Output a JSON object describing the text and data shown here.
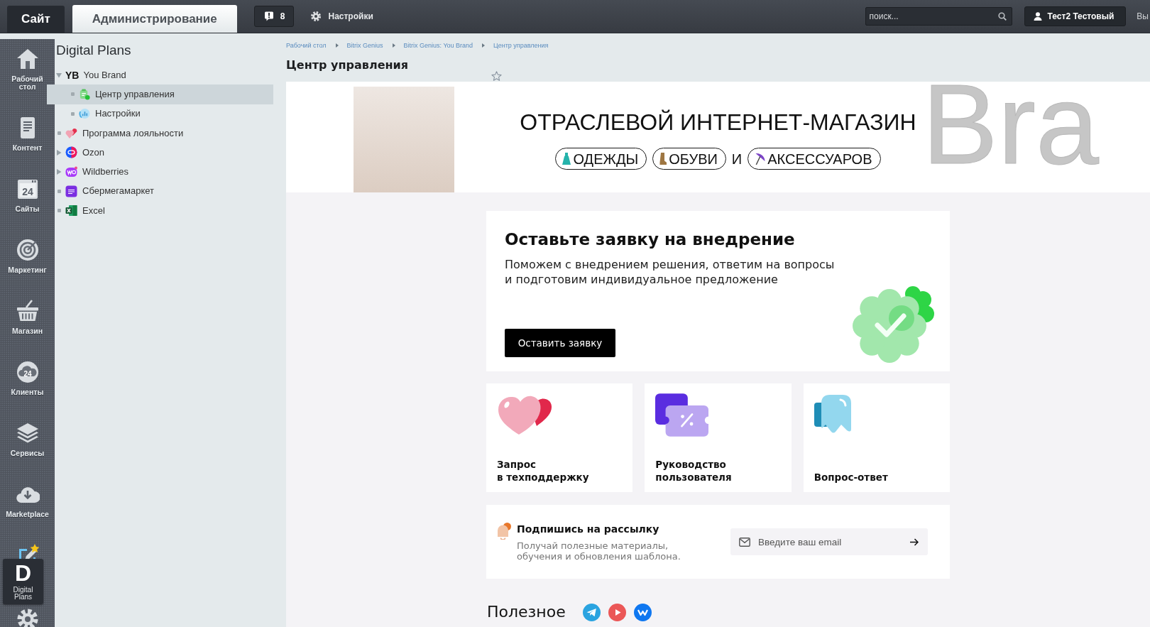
{
  "top_bar": {
    "tabs": [
      {
        "label": "Сайт",
        "selected": false
      },
      {
        "label": "Администрирование",
        "selected": true
      }
    ],
    "notifications": {
      "count": "8"
    },
    "settings": {
      "label": "Настройки"
    },
    "search": {
      "placeholder": "поиск..."
    },
    "user": {
      "name": "Тест2 Тестовый"
    },
    "logout": {
      "label": "Вы"
    }
  },
  "sidebar": {
    "items": [
      {
        "kind": "entry",
        "label": "Рабочий стол"
      },
      {
        "kind": "entry",
        "label": "Контент"
      },
      {
        "kind": "entry",
        "label": "Сайты",
        "icon_text": "24"
      },
      {
        "kind": "entry",
        "label": "Маркетинг"
      },
      {
        "kind": "entry",
        "label": "Магазин"
      },
      {
        "kind": "entry",
        "label": "Клиенты",
        "icon_text": "24"
      },
      {
        "kind": "entry",
        "label": "Сервисы"
      },
      {
        "kind": "entry",
        "label": "Marketplace"
      },
      {
        "kind": "icon"
      },
      {
        "kind": "icon"
      }
    ],
    "popup": {
      "logo": "D",
      "label": "Digital Plans"
    }
  },
  "tree": {
    "title": "Digital Plans",
    "items": [
      {
        "label": "You Brand",
        "badge": "YB",
        "expanded": true,
        "selected": false,
        "children": [
          {
            "label": "Центр управления",
            "selected": true
          },
          {
            "label": "Настройки",
            "selected": false
          }
        ]
      },
      {
        "label": "Программа лояльности",
        "selected": false
      },
      {
        "label": "Ozon",
        "expanded": false,
        "selected": false
      },
      {
        "label": "Wildberries",
        "expanded": false,
        "selected": false
      },
      {
        "label": "Сбермегамаркет",
        "selected": false
      },
      {
        "label": "Excel",
        "selected": false
      }
    ]
  },
  "content": {
    "breadcrumbs": [
      "Рабочий стол",
      "Bitrix Genius",
      "Bitrix Genius: You Brand",
      "Центр управления"
    ],
    "title": "Центр управления",
    "favorite": {
      "starred": false
    },
    "banner": {
      "heading": "ОТРАСЛЕВОЙ ИНТЕРНЕТ-МАГАЗИН",
      "tags": [
        {
          "kind": "pill",
          "label": "ОДЕЖДЫ"
        },
        {
          "kind": "pill",
          "label": "ОБУВИ"
        },
        {
          "kind": "word",
          "label": "И"
        },
        {
          "kind": "pill",
          "label": "АКСЕССУАРОВ"
        }
      ],
      "backdrop": "Bra"
    },
    "request": {
      "title": "Оставьте заявку на внедрение",
      "text": "Поможем с внедрением решения, ответим на вопросы\nи подготовим индивидуальное предложение",
      "button": "Оставить заявку"
    },
    "links": [
      {
        "label": "Запрос\nв техподдержку"
      },
      {
        "label": "Руководство\nпользователя"
      },
      {
        "label": "Вопрос-ответ"
      }
    ],
    "subscribe": {
      "title": "Подпишись на рассылку",
      "text": "Получай полезные материалы,\nобучения и обновления шаблона.",
      "email": {
        "placeholder": "Введите ваш email"
      }
    },
    "useful": {
      "title": "Полезное"
    }
  }
}
